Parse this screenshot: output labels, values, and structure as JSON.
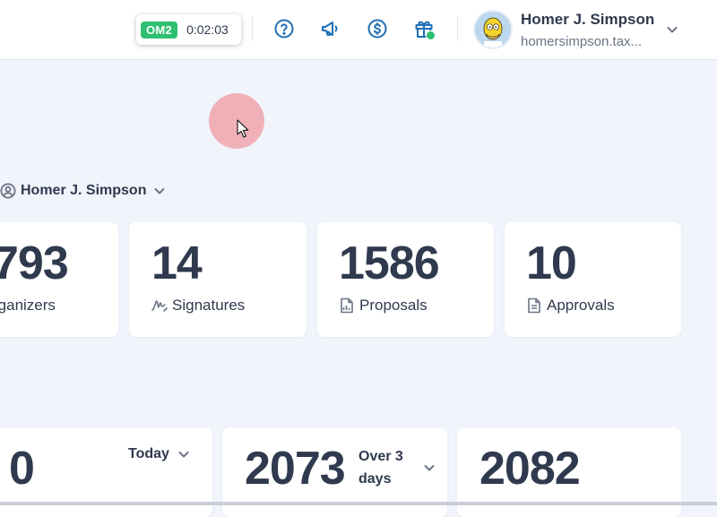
{
  "topbar": {
    "timer": {
      "badge": "OM2",
      "elapsed": "0:02:03"
    },
    "icons": [
      "help-icon",
      "announcement-icon",
      "billing-icon",
      "gift-icon"
    ],
    "user": {
      "name": "Homer J. Simpson",
      "email": "homersimpson.tax..."
    }
  },
  "filter": {
    "user_label": "Homer J. Simpson"
  },
  "stats_row1": [
    {
      "value": "793",
      "label": "rganizers"
    },
    {
      "value": "14",
      "label": "Signatures",
      "icon": "signature-icon"
    },
    {
      "value": "1586",
      "label": "Proposals",
      "icon": "proposal-doc-icon"
    },
    {
      "value": "10",
      "label": "Approvals",
      "icon": "approval-doc-icon"
    }
  ],
  "stats_row2": [
    {
      "value": "0",
      "range": "Today"
    },
    {
      "value": "2073",
      "range_line1": "Over 3",
      "range_line2": "days"
    },
    {
      "value": "2082"
    }
  ],
  "colors": {
    "accent": "#1f6fb5",
    "success": "#2fbf71",
    "text": "#2f3a4e",
    "background": "#f1f4fb"
  }
}
